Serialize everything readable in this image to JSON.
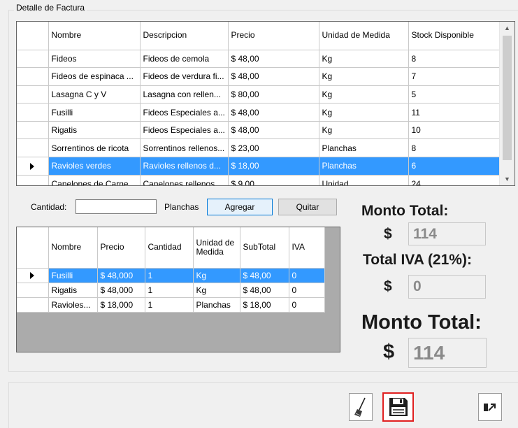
{
  "group": {
    "title": "Detalle de Factura"
  },
  "products_grid": {
    "columns": [
      "Nombre",
      "Descripcion",
      "Precio",
      "Unidad de Medida",
      "Stock Disponible"
    ],
    "rows": [
      [
        "Fideos",
        "Fideos de cemola",
        "$ 48,00",
        "Kg",
        "8"
      ],
      [
        "Fideos de espinaca ...",
        "Fideos de verdura fi...",
        "$ 48,00",
        "Kg",
        "7"
      ],
      [
        "Lasagna C y V",
        "Lasagna con rellen...",
        "$ 80,00",
        "Kg",
        "5"
      ],
      [
        "Fusilli",
        "Fideos Especiales a...",
        "$ 48,00",
        "Kg",
        "11"
      ],
      [
        "Rigatis",
        "Fideos Especiales a...",
        "$ 48,00",
        "Kg",
        "10"
      ],
      [
        "Sorrentinos de ricota",
        "Sorrentinos rellenos...",
        "$ 23,00",
        "Planchas",
        "8"
      ],
      [
        "Ravioles verdes",
        "Ravioles rellenos d...",
        "$ 18,00",
        "Planchas",
        "6"
      ],
      [
        "Canelones de Carne",
        "Canelones rellenos ...",
        "$ 9,00",
        "Unidad",
        "24"
      ]
    ],
    "selected_index": 6
  },
  "quantity": {
    "label": "Cantidad:",
    "value": "",
    "unit_label": "Planchas",
    "add_button": "Agregar",
    "remove_button": "Quitar"
  },
  "detail_grid": {
    "columns": [
      "Nombre",
      "Precio",
      "Cantidad",
      "Unidad de Medida",
      "SubTotal",
      "IVA"
    ],
    "rows": [
      [
        "Fusilli",
        "$ 48,000",
        "1",
        "Kg",
        "$ 48,00",
        "0"
      ],
      [
        "Rigatis",
        "$ 48,000",
        "1",
        "Kg",
        "$ 48,00",
        "0"
      ],
      [
        "Ravioles...",
        "$ 18,000",
        "1",
        "Planchas",
        "$ 18,00",
        "0"
      ]
    ],
    "selected_index": 0
  },
  "totals": {
    "monto_label": "Monto Total:",
    "currency": "$",
    "monto_value": "114",
    "iva_label": "Total IVA (21%):",
    "iva_value": "0",
    "monto_final_label": "Monto Total:",
    "monto_final_value": "114"
  },
  "toolbar": {
    "clear_icon": "broom-icon",
    "save_icon": "floppy-disk-icon",
    "exit_icon": "exit-icon"
  },
  "colors": {
    "selection": "#3399ff",
    "save_highlight": "#e02020"
  }
}
